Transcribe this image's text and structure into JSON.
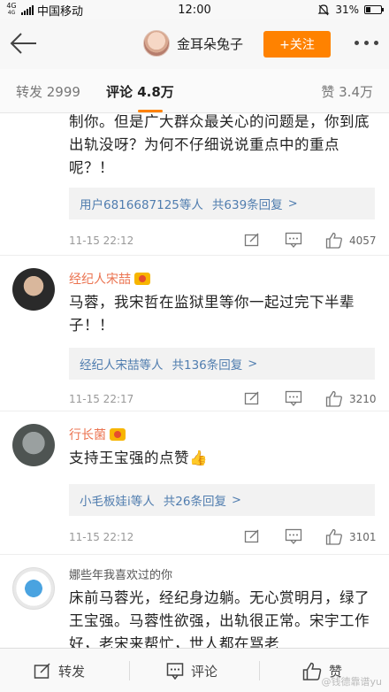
{
  "status_bar": {
    "network": "4G",
    "network_sub": "4G",
    "carrier": "中国移动",
    "time": "12:00",
    "battery": "31%",
    "battery_level": 0.31
  },
  "header": {
    "profile_name": "金耳朵兔子",
    "follow_label": "+关注",
    "avatar_icon": "user-avatar"
  },
  "tabs": [
    {
      "label": "转发 2999"
    },
    {
      "label": "评论 4.8万"
    },
    {
      "label": "赞 3.4万"
    }
  ],
  "comments": [
    {
      "name": "",
      "text": "制你。但是广大群众最关心的问题是，你到底出轨没呀？为何不仔细说说重点中的重点呢？！",
      "replies_user": "用户6816687125等人",
      "replies_count": "共639条回复",
      "time": "11-15 22:12",
      "likes": "4057"
    },
    {
      "name": "经纪人宋喆",
      "text": "马蓉，我宋哲在监狱里等你一起过完下半辈子！！",
      "replies_user": "经纪人宋喆等人",
      "replies_count": "共136条回复",
      "time": "11-15 22:17",
      "likes": "3210"
    },
    {
      "name": "行长菌",
      "text": "支持王宝强的点赞👍",
      "replies_user": "小毛板娃i等人",
      "replies_count": "共26条回复",
      "time": "11-15 22:12",
      "likes": "3101"
    },
    {
      "name": "娜些年我喜欢过的你",
      "text": "床前马蓉光，经纪身边躺。无心赏明月，绿了王宝强。马蓉性欲强，出轨很正常。宋宇工作好，老宋来帮忙，世人都在骂老"
    }
  ],
  "bottom_bar": {
    "repost_label": "转发",
    "comment_label": "评论",
    "like_label": "赞",
    "watermark": "@钱德靠谱yu"
  },
  "colors": {
    "accent": "#ff8200",
    "link": "#507daf",
    "name": "#eb7350"
  }
}
